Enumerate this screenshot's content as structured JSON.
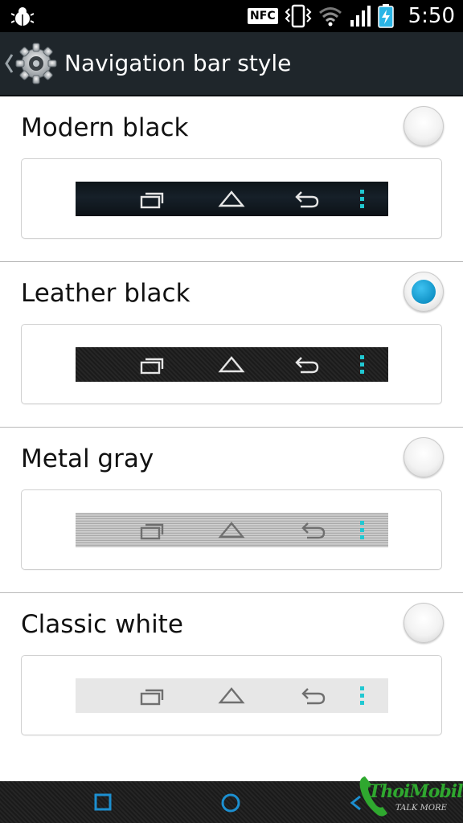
{
  "status_bar": {
    "nfc_label": "NFC",
    "time": "5:50",
    "icons": [
      "debug-icon",
      "nfc-icon",
      "vibrate-icon",
      "wifi-icon",
      "signal-icon",
      "battery-charging-icon"
    ]
  },
  "action_bar": {
    "title": "Navigation bar style",
    "icons": [
      "back-chevron-icon",
      "gear-icon"
    ]
  },
  "options": [
    {
      "label": "Modern black",
      "selected": false
    },
    {
      "label": "Leather black",
      "selected": true
    },
    {
      "label": "Metal gray",
      "selected": false
    },
    {
      "label": "Classic white",
      "selected": false
    }
  ],
  "preview_icons": [
    "recent-apps-icon",
    "home-icon",
    "back-icon",
    "menu-dots-icon"
  ],
  "nav_bar": {
    "icons": [
      "recent-apps-icon",
      "home-icon",
      "back-icon"
    ]
  },
  "watermark": {
    "text": "ThoiMobile",
    "tagline": "TALK MORE"
  },
  "colors": {
    "accent": "#1294c8",
    "action_bar": "#1f262b",
    "menu_dots": "#21c8d2"
  }
}
